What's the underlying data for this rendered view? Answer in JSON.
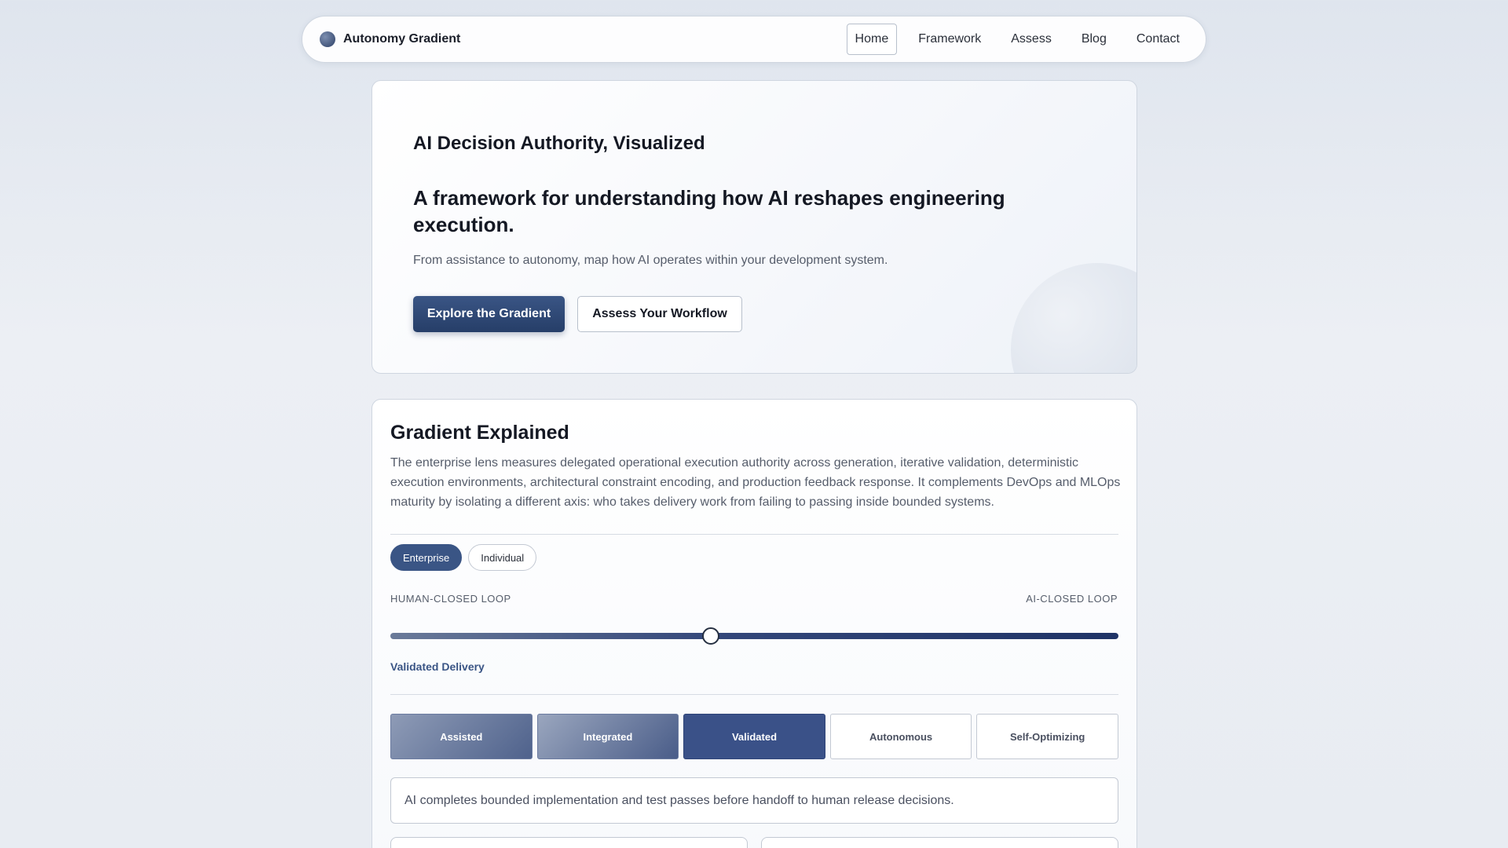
{
  "nav": {
    "brand": "Autonomy Gradient",
    "links": [
      "Home",
      "Framework",
      "Assess",
      "Blog",
      "Contact"
    ],
    "active": "Home"
  },
  "hero": {
    "kicker": "AI Decision Authority, Visualized",
    "title": "A framework for understanding how AI reshapes engineering execution.",
    "subtitle": "From assistance to autonomy, map how AI operates within your development system.",
    "primary_cta": "Explore the Gradient",
    "secondary_cta": "Assess Your Workflow"
  },
  "gradient": {
    "title": "Gradient Explained",
    "description": "The enterprise lens measures delegated operational execution authority across generation, iterative validation, deterministic execution environments, architectural constraint encoding, and production feedback response. It complements DevOps and MLOps maturity by isolating a different axis: who takes delivery work from failing to passing inside bounded systems.",
    "lenses": [
      "Enterprise",
      "Individual"
    ],
    "active_lens": "Enterprise",
    "axis_left": "HUMAN-CLOSED LOOP",
    "axis_right": "AI-CLOSED LOOP",
    "slider_position": 0.44,
    "current_stage_label": "Validated Delivery",
    "stages": [
      "Assisted",
      "Integrated",
      "Validated",
      "Autonomous",
      "Self-Optimizing"
    ],
    "current_stage_index": 2,
    "stage_description": "AI completes bounded implementation and test passes before handoff to human release decisions."
  },
  "colors": {
    "accent": "#3a5585",
    "accent_dark": "#263e68",
    "border": "#cfd6e0",
    "text_muted": "#565d6b"
  },
  "icons": {
    "brand": "brand-orb-icon"
  }
}
